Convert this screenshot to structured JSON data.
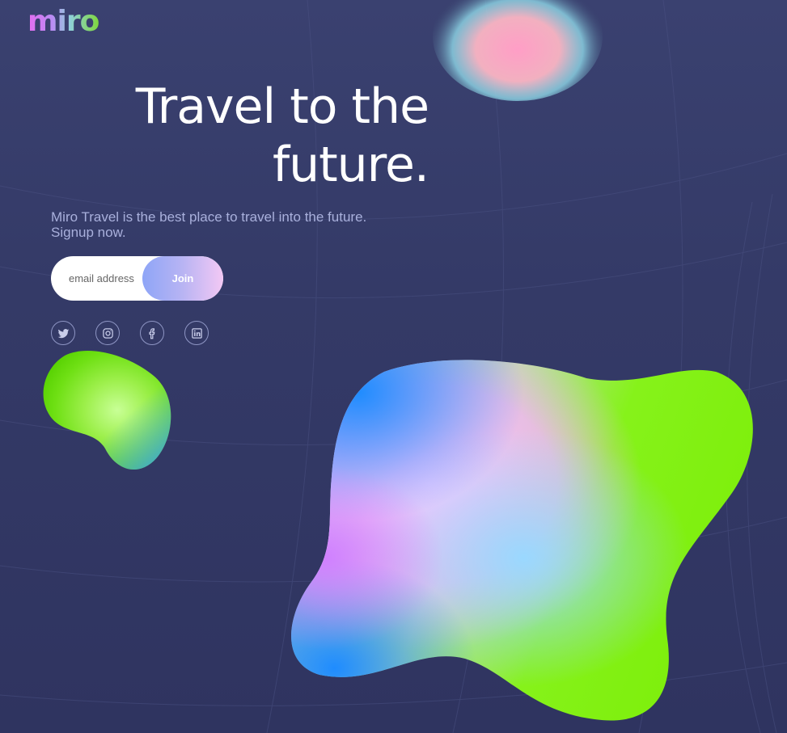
{
  "brand": {
    "logo_text": "miro"
  },
  "hero": {
    "title_line1": "Travel to the",
    "title_line2": "future.",
    "subtitle_line1": "Miro Travel is the best place to travel into the future.",
    "subtitle_line2": "Signup now."
  },
  "signup": {
    "email_placeholder": "email address",
    "join_label": "Join"
  },
  "socials": [
    {
      "name": "twitter-icon"
    },
    {
      "name": "instagram-icon"
    },
    {
      "name": "facebook-icon"
    },
    {
      "name": "linkedin-icon"
    }
  ],
  "colors": {
    "background": "#343a66",
    "text_primary": "#ffffff",
    "text_secondary": "#a9b0dc",
    "accent_green": "#7fef0f",
    "accent_pink": "#ffc0f8",
    "accent_blue": "#1f8cff"
  }
}
